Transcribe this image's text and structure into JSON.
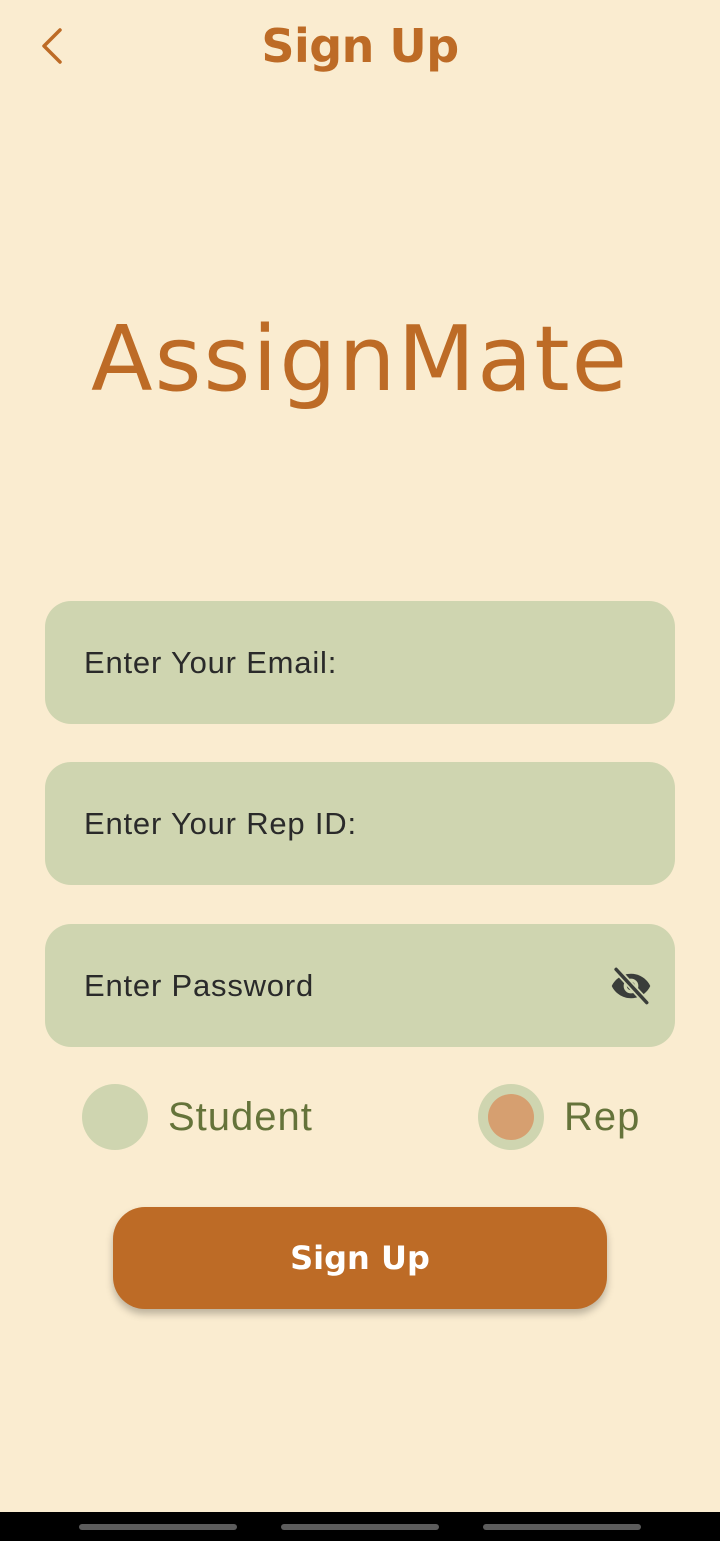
{
  "header": {
    "title": "Sign Up",
    "back_icon": "chevron-left-icon"
  },
  "logo": {
    "text": "AssignMate"
  },
  "form": {
    "email_placeholder": "Enter Your Email:",
    "rep_id_placeholder": "Enter Your Rep ID:",
    "password_placeholder": "Enter Password",
    "password_toggle_icon": "eye-off-icon"
  },
  "role": {
    "student_label": "Student",
    "rep_label": "Rep",
    "selected": "Rep"
  },
  "button": {
    "signup_label": "Sign Up"
  },
  "colors": {
    "background": "#faecd0",
    "accent": "#bd6b26",
    "field": "#cfd5b0",
    "radio_label": "#65733a",
    "radio_selected": "#d69f70"
  }
}
